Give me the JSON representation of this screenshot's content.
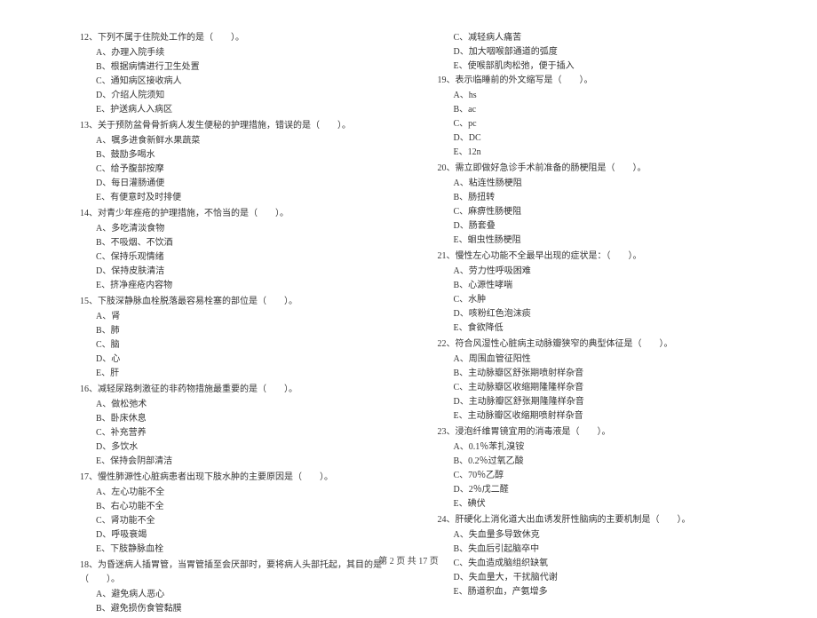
{
  "footer": "第 2 页 共 17 页",
  "left_questions": [
    {
      "num": "12",
      "title": "下列不属于住院处工作的是（　　）。",
      "options": [
        "A、办理入院手续",
        "B、根据病情进行卫生处置",
        "C、通知病区接收病人",
        "D、介绍人院须知",
        "E、护送病人入病区"
      ]
    },
    {
      "num": "13",
      "title": "关于预防盆骨骨折病人发生便秘的护理措施，错误的是（　　）。",
      "options": [
        "A、嘱多进食新鲜水果蔬菜",
        "B、鼓励多喝水",
        "C、给予腹部按摩",
        "D、每日灌肠通便",
        "E、有便意时及时排便"
      ]
    },
    {
      "num": "14",
      "title": "对青少年痤疮的护理措施，不恰当的是（　　）。",
      "options": [
        "A、多吃清淡食物",
        "B、不吸烟、不饮酒",
        "C、保持乐观情绪",
        "D、保持皮肤清洁",
        "E、挤净痤疮内容物"
      ]
    },
    {
      "num": "15",
      "title": "下肢深静脉血栓脱落最容易栓塞的部位是（　　）。",
      "options": [
        "A、肾",
        "B、肺",
        "C、脑",
        "D、心",
        "E、肝"
      ]
    },
    {
      "num": "16",
      "title": "减轻尿路刺激征的非药物措施最重要的是（　　）。",
      "options": [
        "A、做松弛术",
        "B、卧床休息",
        "C、补充营养",
        "D、多饮水",
        "E、保持会阴部清洁"
      ]
    },
    {
      "num": "17",
      "title": "慢性肺源性心脏病患者出现下肢水肿的主要原因是（　　）。",
      "options": [
        "A、左心功能不全",
        "B、右心功能不全",
        "C、肾功能不全",
        "D、呼吸衰竭",
        "E、下肢静脉血栓"
      ]
    },
    {
      "num": "18",
      "title": "为昏迷病人插胃管，当胃管插至会厌部时，要将病人头部托起，其目的是（　　）。",
      "options": [
        "A、避免病人恶心",
        "B、避免损伤食管黏膜"
      ]
    }
  ],
  "right_continue_options": [
    "C、减轻病人痛苦",
    "D、加大咽喉部通道的弧度",
    "E、使喉部肌肉松弛，便于插入"
  ],
  "right_questions": [
    {
      "num": "19",
      "title": "表示临睡前的外文缩写是（　　）。",
      "options": [
        "A、hs",
        "B、ac",
        "C、pc",
        "D、DC",
        "E、12n"
      ]
    },
    {
      "num": "20",
      "title": "需立即做好急诊手术前准备的肠梗阻是（　　）。",
      "options": [
        "A、粘连性肠梗阻",
        "B、肠扭转",
        "C、麻痹性肠梗阻",
        "D、肠套叠",
        "E、蛔虫性肠梗阻"
      ]
    },
    {
      "num": "21",
      "title": "慢性左心功能不全最早出现的症状是：（　　）。",
      "options": [
        "A、劳力性呼吸困难",
        "B、心源性哮喘",
        "C、水肿",
        "D、咳粉红色泡沫痰",
        "E、食欲降低"
      ]
    },
    {
      "num": "22",
      "title": "符合风湿性心脏病主动脉瓣狭窄的典型体征是（　　）。",
      "options": [
        "A、周围血管征阳性",
        "B、主动脉瓣区舒张期喷射样杂音",
        "C、主动脉瓣区收缩期隆隆样杂音",
        "D、主动脉瓣区舒张期隆隆样杂音",
        "E、主动脉瓣区收缩期喷射样杂音"
      ]
    },
    {
      "num": "23",
      "title": "浸泡纤维胃镜宜用的消毒液是（　　）。",
      "options": [
        "A、0.1％苯扎溴铵",
        "B、0.2％过氧乙酸",
        "C、70％乙醇",
        "D、2％戊二醛",
        "E、碘伏"
      ]
    },
    {
      "num": "24",
      "title": "肝硬化上消化道大出血诱发肝性脑病的主要机制是（　　）。",
      "options": [
        "A、失血量多导致休克",
        "B、失血后引起脑卒中",
        "C、失血造成脑组织缺氧",
        "D、失血量大，干扰脑代谢",
        "E、肠道积血，产氨增多"
      ]
    }
  ]
}
